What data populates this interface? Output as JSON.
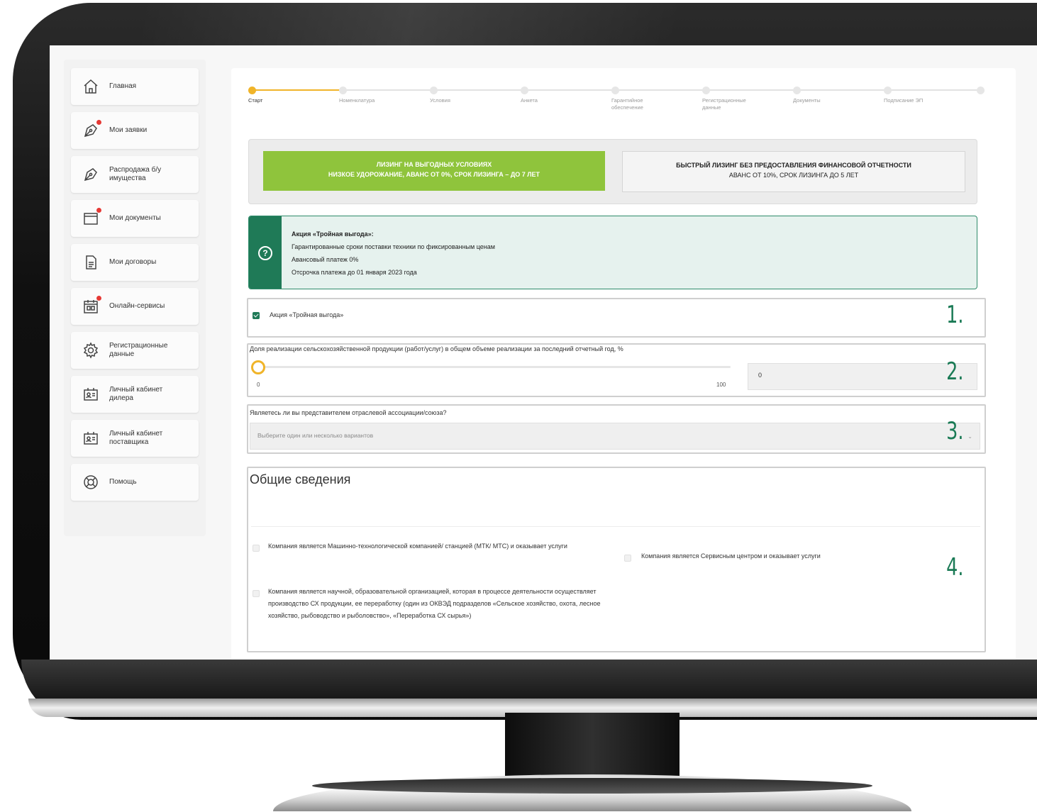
{
  "sidebar": {
    "items": [
      {
        "icon": "home-icon",
        "label": "Главная",
        "badge": false
      },
      {
        "icon": "pen-icon",
        "label": "Мои заявки",
        "badge": true
      },
      {
        "icon": "pen-icon",
        "label": "Распродажа б/у имущества",
        "badge": false
      },
      {
        "icon": "folder-icon",
        "label": "Мои документы",
        "badge": true
      },
      {
        "icon": "document-icon",
        "label": "Мои договоры",
        "badge": false
      },
      {
        "icon": "calendar-icon",
        "label": "Онлайн-сервисы",
        "badge": true
      },
      {
        "icon": "gear-icon",
        "label": "Регистрационные данные",
        "badge": false
      },
      {
        "icon": "id-card-icon",
        "label": "Личный кабинет дилера",
        "badge": false
      },
      {
        "icon": "id-card-icon",
        "label": "Личный кабинет поставщика",
        "badge": false
      },
      {
        "icon": "lifebuoy-icon",
        "label": "Помощь",
        "badge": false
      }
    ]
  },
  "stepper": {
    "steps": [
      {
        "label": "Старт",
        "active": true
      },
      {
        "label": "Номенклатура",
        "active": false
      },
      {
        "label": "Условия",
        "active": false
      },
      {
        "label": "Анкета",
        "active": false
      },
      {
        "label": "Гарантийное обеспечение",
        "active": false
      },
      {
        "label": "Регистрационные данные",
        "active": false
      },
      {
        "label": "Документы",
        "active": false
      },
      {
        "label": "Подписание ЭП",
        "active": false
      }
    ]
  },
  "offers": {
    "green": {
      "line1": "ЛИЗИНГ НА ВЫГОДНЫХ УСЛОВИЯХ",
      "line2": "НИЗКОЕ УДОРОЖАНИЕ, АВАНС ОТ 0%, СРОК ЛИЗИНГА – ДО 7 ЛЕТ"
    },
    "grey": {
      "line1": "БЫСТРЫЙ ЛИЗИНГ БЕЗ ПРЕДОСТАВЛЕНИЯ ФИНАНСОВОЙ ОТЧЕТНОСТИ",
      "line2": "АВАНС ОТ 10%, СРОК ЛИЗИНГА ДО 5 ЛЕТ"
    }
  },
  "promo": {
    "icon": "?",
    "title": "Акция «Тройная выгода»:",
    "lines": [
      "Гарантированные сроки поставки техники по фиксированным ценам",
      "Авансовый платеж 0%",
      "Отсрочка платежа до 01 января 2023 года"
    ]
  },
  "section1": {
    "number": "1.",
    "checkbox_label": "Акция «Тройная выгода»",
    "checked": true
  },
  "section2": {
    "number": "2.",
    "label": "Доля реализации сельскохозяйственной продукции (работ/услуг) в общем объеме реализации за последний отчетный год, %",
    "min": "0",
    "max": "100",
    "value": "0"
  },
  "section3": {
    "number": "3.",
    "label": "Являетесь ли вы представителем отраслевой ассоциации/союза?",
    "placeholder": "Выберите один или несколько вариантов"
  },
  "section4": {
    "number": "4.",
    "title": "Общие сведения",
    "options": [
      {
        "label": "Компания является Машинно-технологической компанией/ станцией (МТК/ МТС) и оказывает услуги",
        "checked": false
      },
      {
        "label": "Компания является Сервисным центром и оказывает услуги",
        "checked": false
      },
      {
        "label": "Компания является научной, образовательной организацией, которая в процессе деятельности осуществляет производство СХ продукции, ее переработку (один из ОКВЭД подразделов «Сельское хозяйство, охота, лесное хозяйство, рыбоводство и рыболовство», «Переработка СХ сырья»)",
        "checked": false
      }
    ]
  },
  "colors": {
    "accent_green": "#1f7a57",
    "offer_green": "#8fc43c",
    "step_active": "#f0b429"
  }
}
